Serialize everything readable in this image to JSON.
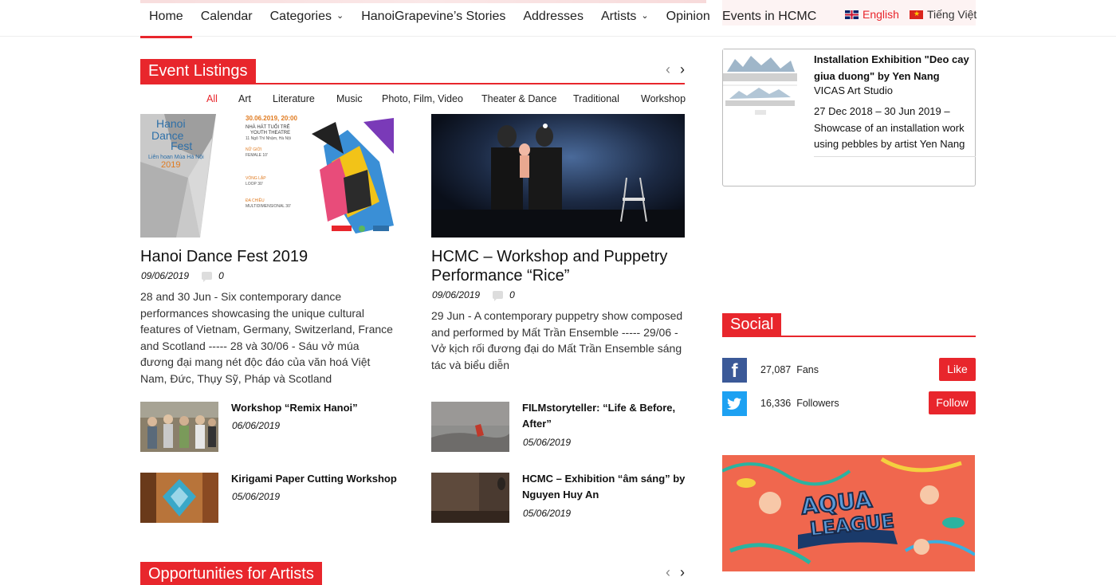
{
  "nav": {
    "items": [
      {
        "label": "Home",
        "active": true
      },
      {
        "label": "Calendar"
      },
      {
        "label": "Categories",
        "dropdown": true
      },
      {
        "label": "HanoiGrapevine’s Stories"
      },
      {
        "label": "Addresses"
      },
      {
        "label": "Artists",
        "dropdown": true
      },
      {
        "label": "Opinion"
      }
    ],
    "events_hcmc": "Events in HCMC",
    "lang_en": "English",
    "lang_vi": "Tiếng Việt"
  },
  "events": {
    "heading": "Event Listings",
    "filters": [
      "All",
      "Art",
      "Literature",
      "Music",
      "Photo, Film, Video",
      "Theater & Dance",
      "Traditional",
      "Workshop"
    ],
    "featured": [
      {
        "title": "Hanoi Dance Fest 2019",
        "date": "09/06/2019",
        "comments": "0",
        "excerpt": "28 and 30 Jun - Six contemporary dance performances showcasing the unique cultural features of Vietnam, Germany, Switzerland, France and Scotland ----- 28 và 30/06 - Sáu vở múa đương đại mang nét độc đáo của văn hoá Việt Nam, Đức, Thụy Sỹ, Pháp và Scotland",
        "poster": {
          "brand_line1": "Hanoi",
          "brand_line2": "Dance",
          "brand_line3": "Fest",
          "brand_sub": "Liên hoan Múa Hà Nội",
          "year": "2019",
          "datetime": "30.06.2019, 20:00",
          "venue": "NHÀ HÁT TUỔI TRẺ",
          "venue_en": "YOUTH THEATRE",
          "address": "11 Ngô Thì Nhậm, Hà Nội",
          "lineup": [
            "NỮ GIỚI",
            "FEMALE 10'",
            "VÒNG LẶP",
            "LOOP 30'",
            "ĐA CHIỀU",
            "MULTIDIMENSIONAL 30'"
          ]
        }
      },
      {
        "title": "HCMC – Workshop and Puppetry Performance “Rice”",
        "date": "09/06/2019",
        "comments": "0",
        "excerpt": "29 Jun - A contemporary puppetry show composed and performed by Mất Trần Ensemble ----- 29/06 - Vở kịch rối đương đại do Mất Trần Ensemble sáng tác và biểu diễn"
      }
    ],
    "list_left": [
      {
        "title": "Workshop “Remix Hanoi”",
        "date": "06/06/2019"
      },
      {
        "title": "Kirigami Paper Cutting Workshop",
        "date": "05/06/2019"
      }
    ],
    "list_right": [
      {
        "title": "FILMstoryteller: “Life & Before, After”",
        "date": "05/06/2019"
      },
      {
        "title": "HCMC – Exhibition “âm sáng” by Nguyen Huy An",
        "date": "05/06/2019"
      }
    ]
  },
  "opportunities": {
    "heading": "Opportunities for Artists"
  },
  "sidebar": {
    "feature": {
      "title": "Installation Exhibition \"Deo cay giua duong\" by Yen Nang",
      "venue": "VICAS Art Studio",
      "desc": "27 Dec 2018 – 30 Jun 2019 – Showcase of an installation work using pebbles by artist Yen Nang"
    },
    "social": {
      "heading": "Social",
      "facebook": {
        "count": "27,087",
        "unit": "Fans",
        "button": "Like"
      },
      "twitter": {
        "count": "16,336",
        "unit": "Followers",
        "button": "Follow"
      }
    },
    "ad": {
      "line1": "AQUA",
      "line2": "LEAGUE"
    }
  },
  "colors": {
    "accent": "#e8262c",
    "facebook": "#3b5998",
    "twitter": "#1da1f2"
  }
}
